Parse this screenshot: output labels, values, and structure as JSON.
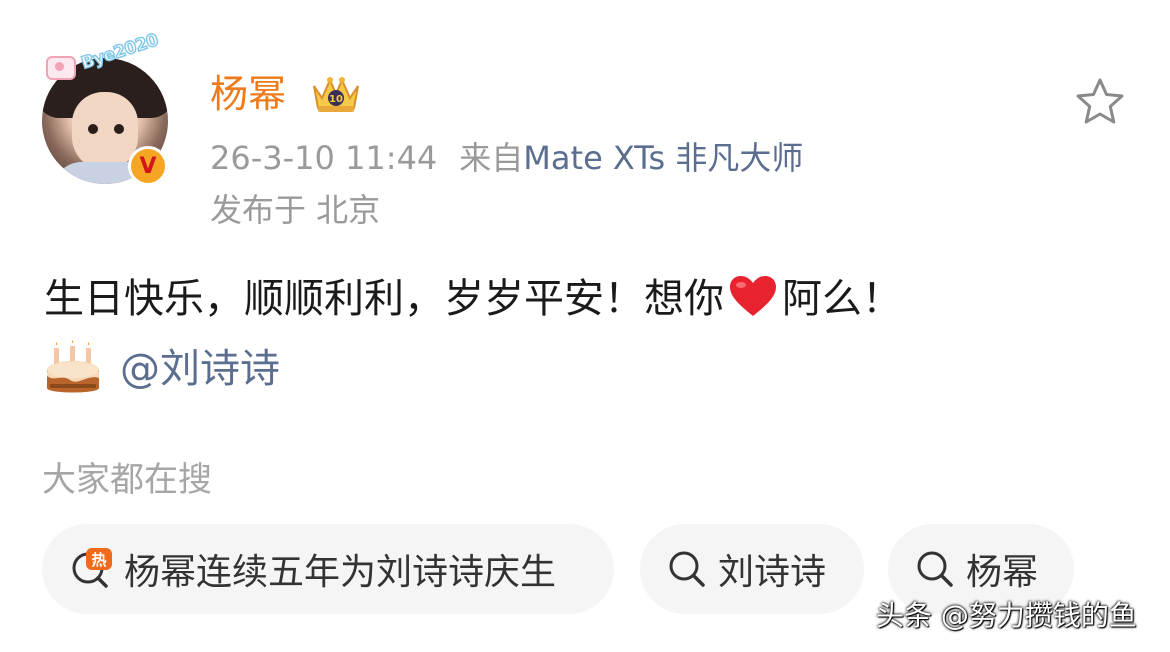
{
  "user": {
    "name": "杨幂",
    "avatar_text": "Bye2020",
    "verified_badge": "V"
  },
  "meta": {
    "datetime": "26-3-10 11:44",
    "source_prefix": "来自",
    "device": "Mate XTs 非凡大师",
    "location": "发布于 北京"
  },
  "post": {
    "text": "生日快乐，顺顺利利，岁岁平安！想你",
    "text_tail": "阿么！",
    "mention": "@刘诗诗"
  },
  "search": {
    "title": "大家都在搜",
    "hot_label": "热",
    "chips": [
      {
        "label": "杨幂连续五年为刘诗诗庆生",
        "icon": "hot-search-icon"
      },
      {
        "label": "刘诗诗",
        "icon": "search-icon"
      },
      {
        "label": "杨幂",
        "icon": "search-icon"
      }
    ]
  },
  "watermark": "头条 @努力攒钱的鱼",
  "colors": {
    "name": "#ee7a1a",
    "link": "#5b6e8f",
    "meta": "#9a9a9a",
    "chip_bg": "#f5f5f5",
    "heart": "#e8232f",
    "hot": "#f06a1c"
  }
}
